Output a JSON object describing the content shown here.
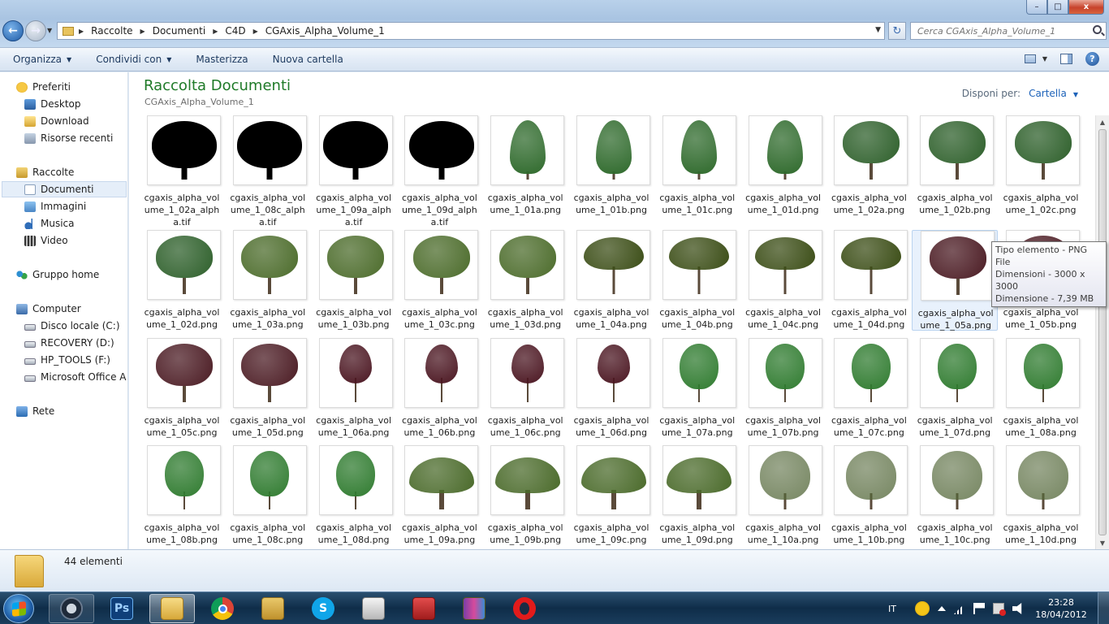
{
  "window": {
    "controls": {
      "minimize": "–",
      "maximize": "□",
      "close": "x"
    }
  },
  "address": {
    "crumbs": [
      "Raccolte",
      "Documenti",
      "C4D",
      "CGAxis_Alpha_Volume_1"
    ],
    "search_placeholder": "Cerca CGAxis_Alpha_Volume_1"
  },
  "toolbar": {
    "organize": "Organizza",
    "share": "Condividi con",
    "burn": "Masterizza",
    "new_folder": "Nuova cartella"
  },
  "nav": {
    "favorites": "Preferiti",
    "desktop": "Desktop",
    "download": "Download",
    "recent": "Risorse recenti",
    "libraries": "Raccolte",
    "documents": "Documenti",
    "images": "Immagini",
    "music": "Musica",
    "video": "Video",
    "homegroup": "Gruppo home",
    "computer": "Computer",
    "drive_c": "Disco locale (C:)",
    "drive_d": "RECOVERY (D:)",
    "drive_f": "HP_TOOLS (F:)",
    "drive_office": "Microsoft Office A p",
    "network": "Rete"
  },
  "content": {
    "title": "Raccolta Documenti",
    "subtitle": "CGAxis_Alpha_Volume_1",
    "arrange_label": "Disponi per:",
    "arrange_value": "Cartella",
    "files": [
      "cgaxis_alpha_volume_1_02a_alpha.tif",
      "cgaxis_alpha_volume_1_08c_alpha.tif",
      "cgaxis_alpha_volume_1_09a_alpha.tif",
      "cgaxis_alpha_volume_1_09d_alpha.tif",
      "cgaxis_alpha_volume_1_01a.png",
      "cgaxis_alpha_volume_1_01b.png",
      "cgaxis_alpha_volume_1_01c.png",
      "cgaxis_alpha_volume_1_01d.png",
      "cgaxis_alpha_volume_1_02a.png",
      "cgaxis_alpha_volume_1_02b.png",
      "cgaxis_alpha_volume_1_02c.png",
      "cgaxis_alpha_volume_1_02d.png",
      "cgaxis_alpha_volume_1_03a.png",
      "cgaxis_alpha_volume_1_03b.png",
      "cgaxis_alpha_volume_1_03c.png",
      "cgaxis_alpha_volume_1_03d.png",
      "cgaxis_alpha_volume_1_04a.png",
      "cgaxis_alpha_volume_1_04b.png",
      "cgaxis_alpha_volume_1_04c.png",
      "cgaxis_alpha_volume_1_04d.png",
      "cgaxis_alpha_volume_1_05a.png",
      "cgaxis_alpha_volume_1_05b.png",
      "cgaxis_alpha_volume_1_05c.png",
      "cgaxis_alpha_volume_1_05d.png",
      "cgaxis_alpha_volume_1_06a.png",
      "cgaxis_alpha_volume_1_06b.png",
      "cgaxis_alpha_volume_1_06c.png",
      "cgaxis_alpha_volume_1_06d.png",
      "cgaxis_alpha_volume_1_07a.png",
      "cgaxis_alpha_volume_1_07b.png",
      "cgaxis_alpha_volume_1_07c.png",
      "cgaxis_alpha_volume_1_07d.png",
      "cgaxis_alpha_volume_1_08a.png",
      "cgaxis_alpha_volume_1_08b.png",
      "cgaxis_alpha_volume_1_08c.png",
      "cgaxis_alpha_volume_1_08d.png",
      "cgaxis_alpha_volume_1_09a.png",
      "cgaxis_alpha_volume_1_09b.png",
      "cgaxis_alpha_volume_1_09c.png",
      "cgaxis_alpha_volume_1_09d.png",
      "cgaxis_alpha_volume_1_10a.png",
      "cgaxis_alpha_volume_1_10b.png",
      "cgaxis_alpha_volume_1_10c.png",
      "cgaxis_alpha_volume_1_10d.png"
    ],
    "thumb_styles": [
      "silhouette",
      "silhouette",
      "silhouette",
      "silhouette",
      "conifer",
      "conifer",
      "conifer",
      "conifer",
      "bushy",
      "bushy",
      "bushy",
      "bushy",
      "leafy",
      "leafy",
      "leafy",
      "leafy",
      "umbrella",
      "umbrella",
      "umbrella",
      "umbrella",
      "purple",
      "purple",
      "purple",
      "purple",
      "purple-slim",
      "purple-slim",
      "purple-slim",
      "purple-slim",
      "green-round",
      "green-round",
      "green-round",
      "green-round",
      "green-round",
      "green-round",
      "green-round",
      "green-round",
      "spread",
      "spread",
      "spread",
      "spread",
      "sparse",
      "sparse",
      "sparse",
      "sparse"
    ],
    "thumb_colors": {
      "silhouette": "#000000",
      "conifer": "#2f6a2c",
      "bushy": "#2d5f2a",
      "leafy": "#4b6b2a",
      "umbrella": "#3b4d16",
      "purple": "#4a1a22",
      "purple-slim": "#4a1520",
      "green-round": "#2f7b2f",
      "spread": "#4a6a2a",
      "sparse": "#54683a"
    },
    "tooltip": [
      "Tipo elemento - PNG File",
      "Dimensioni - 3000 x 3000",
      "Dimensione - 7,39 MB"
    ]
  },
  "details": {
    "count": "44 elementi"
  },
  "taskbar": {
    "apps": [
      "cinema4d-icon",
      "photoshop-icon",
      "explorer-icon",
      "chrome-icon",
      "photo-viewer-icon",
      "skype-icon",
      "video-icon",
      "ares-icon",
      "rar-icon",
      "opera-icon"
    ],
    "photoshop_label": "Ps",
    "lang": "IT",
    "time": "23:28",
    "date": "18/04/2012"
  }
}
